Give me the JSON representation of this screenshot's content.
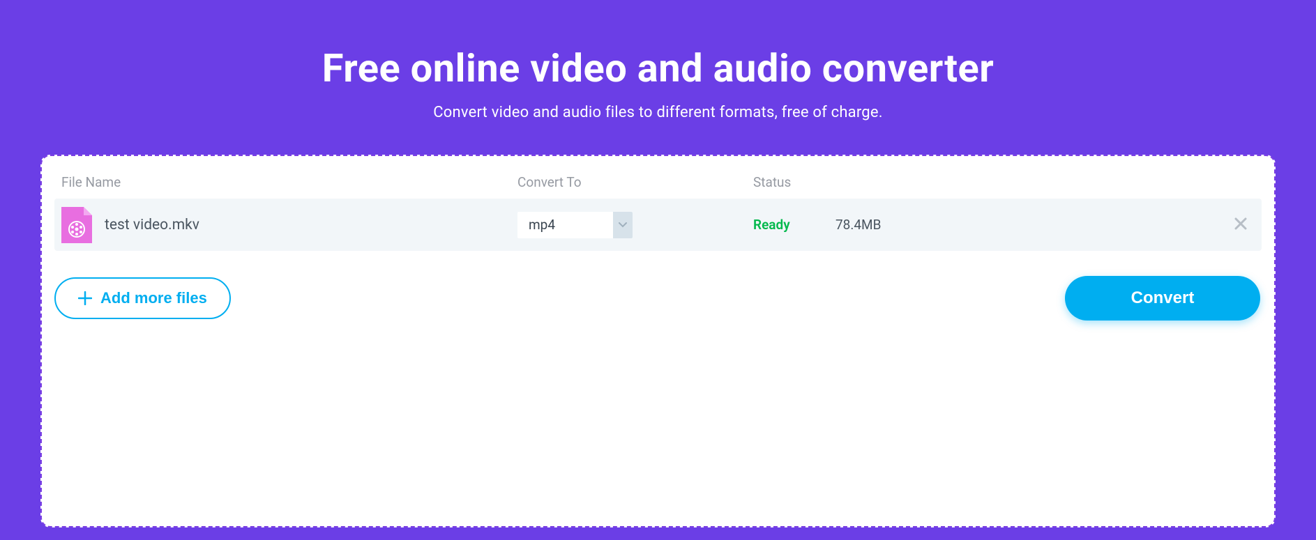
{
  "header": {
    "title": "Free online video and audio converter",
    "subtitle": "Convert video and audio files to different formats, free of charge."
  },
  "table": {
    "headers": {
      "filename": "File Name",
      "convert_to": "Convert To",
      "status": "Status"
    },
    "rows": [
      {
        "filename": "test video.mkv",
        "convert_to": "mp4",
        "status": "Ready",
        "size": "78.4MB"
      }
    ]
  },
  "actions": {
    "add_more_label": "Add more files",
    "convert_label": "Convert"
  },
  "colors": {
    "bg": "#6b3ee6",
    "accent": "#00aef0",
    "status_ready": "#00b84b",
    "file_icon": "#e86ee0"
  }
}
